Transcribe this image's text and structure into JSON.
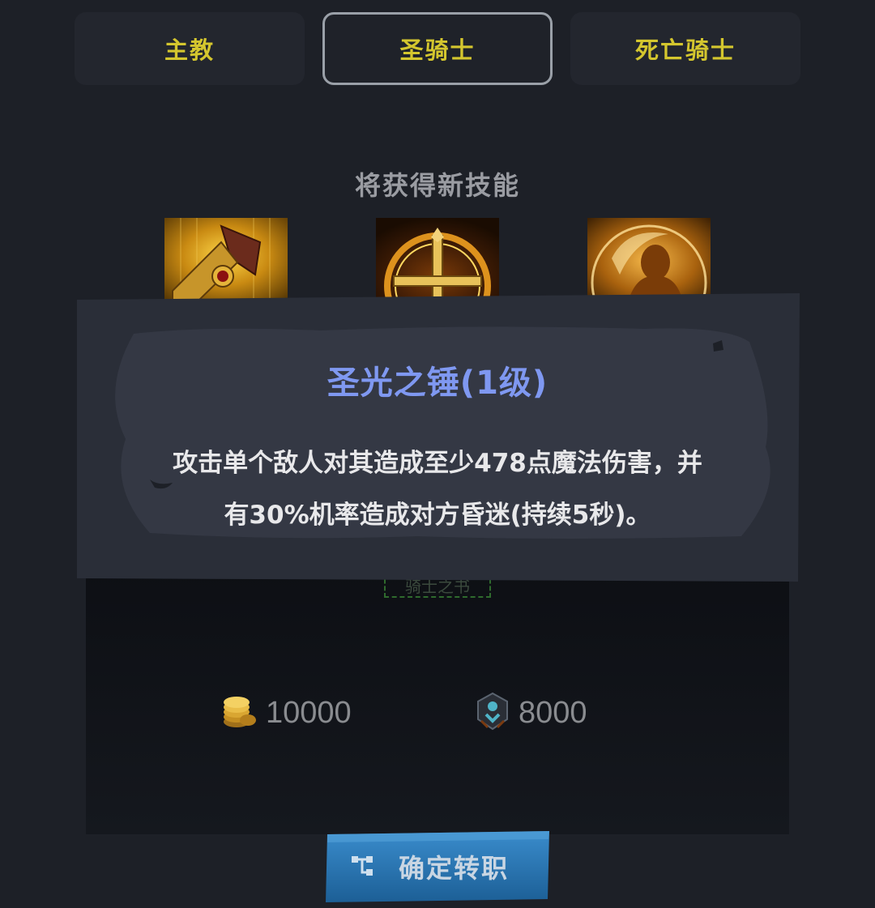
{
  "tabs": [
    {
      "label": "主教"
    },
    {
      "label": "圣骑士"
    },
    {
      "label": "死亡骑士"
    }
  ],
  "new_skills_title": "将获得新技能",
  "skills": [
    {
      "icon": "holy-hammer-icon"
    },
    {
      "icon": "holy-cross-icon"
    },
    {
      "icon": "divine-shield-icon"
    }
  ],
  "tooltip": {
    "title": "圣光之锤(1级)",
    "description_line1": "攻击单个敌人对其造成至少478点魔法伤害，并",
    "description_line2": "有30%机率造成对方昏迷(持续5秒)。"
  },
  "required_item": "骑士之书",
  "costs": {
    "gold": "10000",
    "gem": "8000"
  },
  "confirm_button": "确定转职",
  "colors": {
    "tab_text": "#d4c62e",
    "tooltip_title": "#7f98f1",
    "button": "#2773ad"
  }
}
